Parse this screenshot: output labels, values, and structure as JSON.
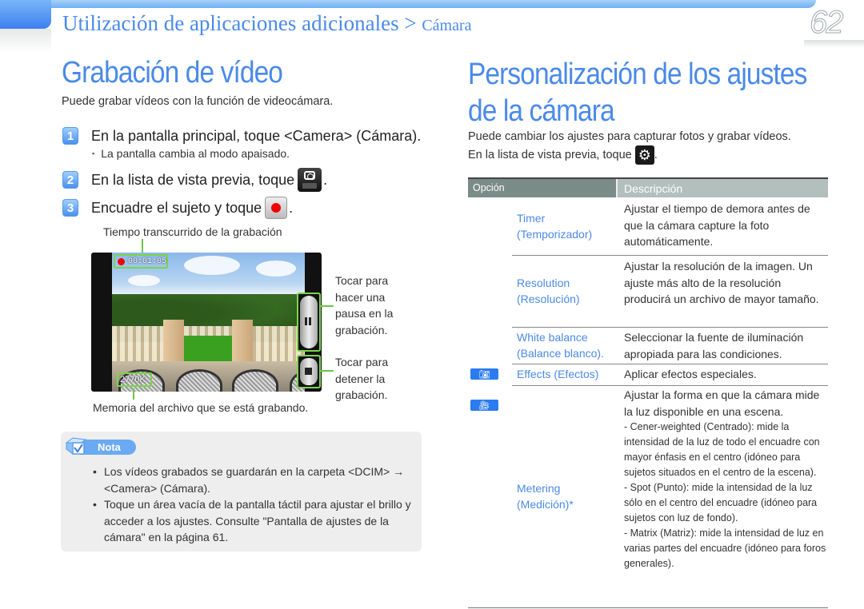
{
  "header": {
    "title": "Utilización de aplicaciones adicionales",
    "separator": ">",
    "subtitle": "Cámara",
    "page_number": "62"
  },
  "left": {
    "heading": "Grabación de vídeo",
    "intro": "Puede grabar vídeos con la función de videocámara.",
    "steps": [
      {
        "num": "1",
        "text": "En la pantalla principal, toque <Camera> (Cámara).",
        "sub": "La pantalla cambia al modo apaisado."
      },
      {
        "num": "2",
        "text": "En la lista de vista previa, toque",
        "icon": "camera-mode-icon"
      },
      {
        "num": "3",
        "text": "Encuadre el sujeto y toque",
        "icon": "record-icon"
      }
    ],
    "period": ".",
    "screen": {
      "elapsed_label": "Tiempo transcurrido de la grabación",
      "elapsed_time": "00:01:05",
      "file_size": "2770K",
      "memory_label": "Memoria del archivo que se está grabando.",
      "pause_label_lines": [
        "Tocar para",
        "hacer una",
        "pausa en la",
        "grabación."
      ],
      "stop_label_lines": [
        "Tocar para",
        "detener la",
        "grabación."
      ]
    },
    "note": {
      "label": "Nota",
      "items": [
        "Los vídeos grabados se guardarán en la carpeta <DCIM> → <Camera> (Cámara).",
        "Toque un área vacía de la pantalla táctil para ajustar el brillo y acceder a los ajustes. Consulte \"Pantalla de ajustes de la cámara\" en la página 61."
      ]
    }
  },
  "right": {
    "heading_line1": "Personalización de los ajustes",
    "heading_line2": "de la cámara",
    "intro_line1": "Puede cambiar los ajustes para capturar fotos y grabar vídeos.",
    "intro_line2": "En la lista de vista previa, toque",
    "period": ".",
    "table": {
      "col_option": "Opción",
      "col_description": "Descripción",
      "rows": [
        {
          "option": "Timer (Temporizador)",
          "description": "Ajustar el tiempo de demora antes de que la cámara capture la foto automáticamente."
        },
        {
          "option": "Resolution (Resolución)",
          "description": "Ajustar la resolución de la imagen. Un ajuste más alto de la resolución producirá un archivo de mayor tamaño."
        },
        {
          "option": "White balance (Balance blanco).",
          "description": "Seleccionar la fuente de iluminación apropiada para las condiciones."
        },
        {
          "option": "Effects (Efectos)",
          "description": "Aplicar efectos especiales.",
          "mode_icon": "photo-mode-icon"
        },
        {
          "option": "Metering (Medición)*",
          "description": "Ajustar la forma en que la cámara mide la luz disponible en una escena.",
          "mode_icon": "video-mode-icon",
          "bullets": [
            "- Cener-weighted (Centrado): mide la intensidad de la luz de todo el encuadre con mayor énfasis en el centro (idóneo para sujetos situados en el centro de la escena).",
            "- Spot (Punto): mide la intensidad de la luz sólo en el centro del encuadre (idóneo para sujetos con luz de fondo).",
            "- Matrix (Matriz): mide la intensidad de luz en varias partes del encuadre (idóneo para foros generales)."
          ]
        }
      ]
    }
  }
}
